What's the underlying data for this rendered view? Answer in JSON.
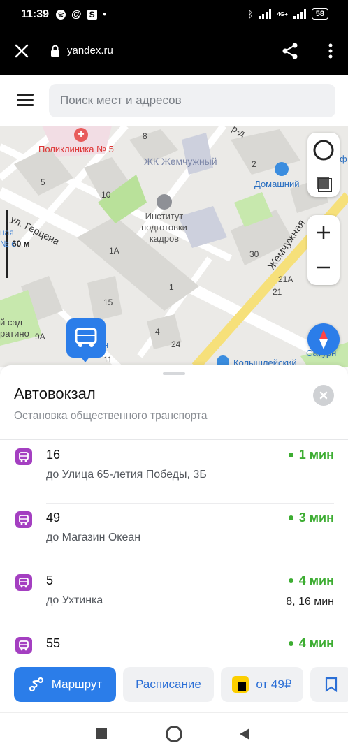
{
  "status_bar": {
    "time": "11:39",
    "network": "4G+",
    "battery": "58"
  },
  "browser": {
    "url": "yandex.ru"
  },
  "search": {
    "placeholder": "Поиск мест и адресов"
  },
  "map": {
    "labels": {
      "clinic": "Поликлиника № 5",
      "jk": "ЖК Жемчужный",
      "shop_domashny": "Домашний",
      "institute": "Институт подготовки кадров",
      "street_gertsena": "ул. Герцена",
      "street_zhemchuzhnaya": "Жемчужная",
      "street_rd": "р-д",
      "scale": "60 м",
      "kolyshleysky": "Колышлейский",
      "saturn": "Сатурн",
      "sad": "й сад",
      "ratino": "ратино",
      "house_8": "8",
      "house_2": "2",
      "house_5": "5",
      "house_10": "10",
      "house_1a": "1А",
      "house_1": "1",
      "house_30": "30",
      "house_21a": "21А",
      "house_21": "21",
      "house_15": "15",
      "house_9a": "9А",
      "house_4": "4",
      "house_24": "24",
      "house_11": "11",
      "frag_f": "ф",
      "frag_n": "н",
      "frag_ya": "ная",
      "frag_nye": "№ е"
    }
  },
  "stop": {
    "title": "Автовокзал",
    "subtitle": "Остановка общественного транспорта"
  },
  "routes": [
    {
      "number": "16",
      "destination": "до Улица 65-летия Победы, 3Б",
      "time": "1 мин",
      "next": ""
    },
    {
      "number": "49",
      "destination": "до Магазин Океан",
      "time": "3 мин",
      "next": ""
    },
    {
      "number": "5",
      "destination": "до Ухтинка",
      "time": "4 мин",
      "next": "8, 16 мин"
    },
    {
      "number": "55",
      "destination": "",
      "time": "4 мин",
      "next": ""
    }
  ],
  "actions": {
    "route": "Маршрут",
    "schedule": "Расписание",
    "taxi": "от 49₽"
  },
  "colors": {
    "accent_blue": "#2b7de9",
    "bus_purple": "#a43fc1",
    "time_green": "#3dad32"
  },
  "icons": [
    "close-icon",
    "lock-icon",
    "share-icon",
    "more-icon",
    "menu-icon",
    "layers-icon",
    "zoom-in-icon",
    "zoom-out-icon",
    "compass-icon",
    "bus-icon",
    "route-icon",
    "bookmark-icon",
    "taxi-icon"
  ]
}
